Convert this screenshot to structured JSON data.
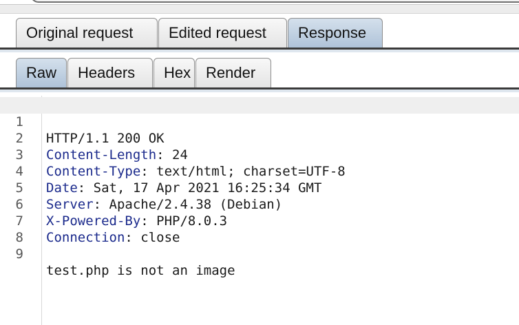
{
  "outer_tabs": [
    {
      "label": "Original request",
      "active": false
    },
    {
      "label": "Edited request",
      "active": false
    },
    {
      "label": "Response",
      "active": true
    }
  ],
  "inner_tabs": [
    {
      "label": "Raw",
      "active": true
    },
    {
      "label": "Headers",
      "active": false
    },
    {
      "label": "Hex",
      "active": false
    },
    {
      "label": "Render",
      "active": false
    }
  ],
  "response": {
    "lines": [
      {
        "num": "1",
        "status": "HTTP/1.1 200 OK"
      },
      {
        "num": "2",
        "key": "Content-Length",
        "sep": ": ",
        "value": "24"
      },
      {
        "num": "3",
        "key": "Content-Type",
        "sep": ": ",
        "value": "text/html; charset=UTF-8"
      },
      {
        "num": "4",
        "key": "Date",
        "sep": ": ",
        "value": "Sat, 17 Apr 2021 16:25:34 GMT"
      },
      {
        "num": "5",
        "key": "Server",
        "sep": ": ",
        "value": "Apache/2.4.38 (Debian)"
      },
      {
        "num": "6",
        "key": "X-Powered-By",
        "sep": ": ",
        "value": "PHP/8.0.3"
      },
      {
        "num": "7",
        "key": "Connection",
        "sep": ": ",
        "value": "close"
      },
      {
        "num": "8"
      },
      {
        "num": "9",
        "body": "test.php is not an image"
      }
    ]
  },
  "colors": {
    "header_key": "#1b2a8c",
    "active_tab": "#aec2d8",
    "current_line": "#efefef"
  }
}
